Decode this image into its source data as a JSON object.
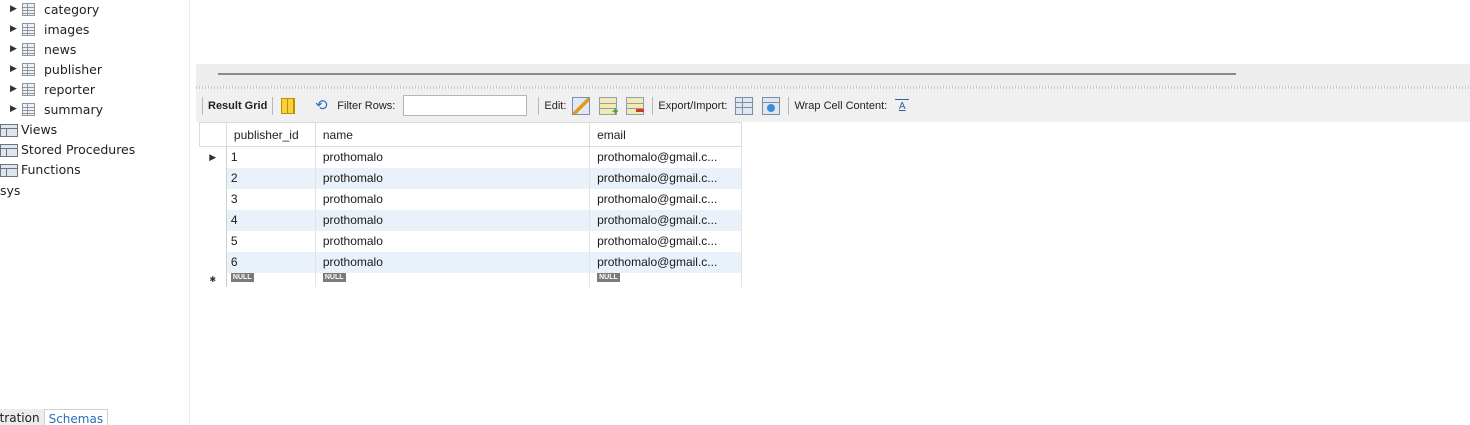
{
  "sidebar": {
    "tables": [
      {
        "label": "category"
      },
      {
        "label": "images"
      },
      {
        "label": "news"
      },
      {
        "label": "publisher"
      },
      {
        "label": "reporter"
      },
      {
        "label": "summary"
      }
    ],
    "folders": [
      {
        "label": "Views"
      },
      {
        "label": "Stored Procedures"
      },
      {
        "label": "Functions"
      }
    ],
    "schema_sys": "sys",
    "tabs": {
      "administration": "istration",
      "schemas": "Schemas"
    }
  },
  "toolbar": {
    "result_grid": "Result Grid",
    "filter_rows": "Filter Rows:",
    "filter_value": "",
    "edit": "Edit:",
    "export_import": "Export/Import:",
    "wrap_cell": "Wrap Cell Content:"
  },
  "grid": {
    "columns": [
      "publisher_id",
      "name",
      "email"
    ],
    "rows": [
      {
        "id": "1",
        "name": "prothomalo",
        "email": "prothomalo@gmail.c..."
      },
      {
        "id": "2",
        "name": "prothomalo",
        "email": "prothomalo@gmail.c..."
      },
      {
        "id": "3",
        "name": "prothomalo",
        "email": "prothomalo@gmail.c..."
      },
      {
        "id": "4",
        "name": "prothomalo",
        "email": "prothomalo@gmail.c..."
      },
      {
        "id": "5",
        "name": "prothomalo",
        "email": "prothomalo@gmail.c..."
      },
      {
        "id": "6",
        "name": "prothomalo",
        "email": "prothomalo@gmail.c..."
      }
    ],
    "null_label": "NULL",
    "current_row_marker": "▶",
    "new_row_marker": "✱"
  },
  "colors": {
    "alt_row": "#e9f1fb",
    "schemas_tab_text": "#2a6fb7",
    "toolbar_bg": "#f0f0f0"
  }
}
